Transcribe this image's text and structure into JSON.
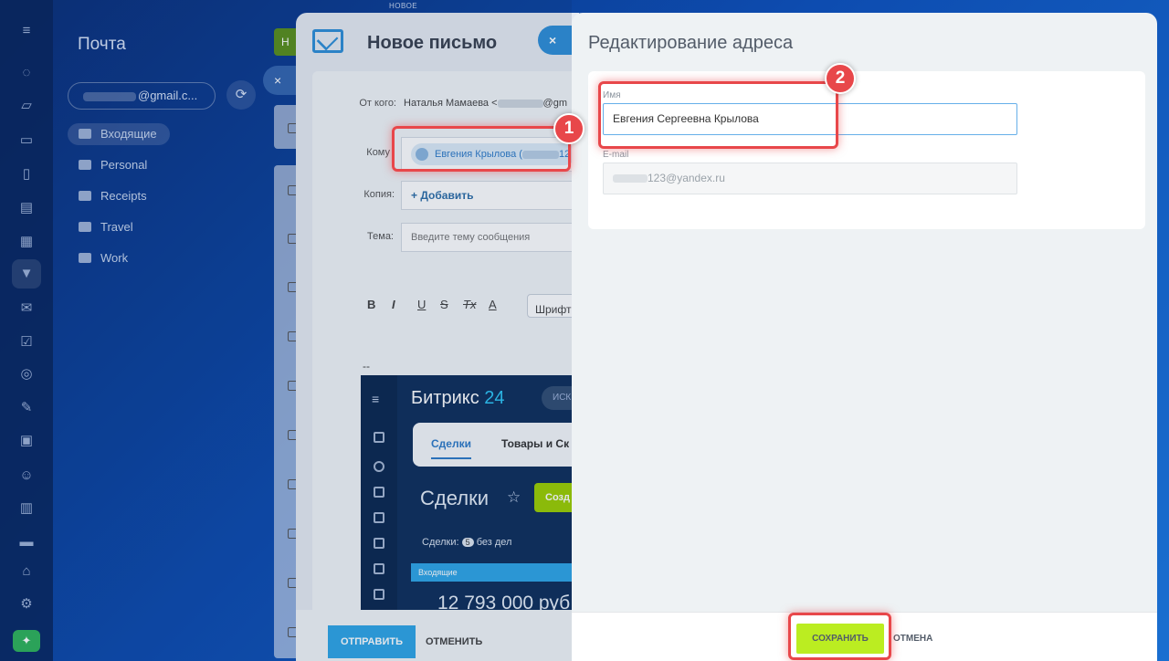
{
  "rail": {
    "icons": [
      "activity-icon",
      "feed-icon",
      "chat-icon",
      "calls-icon",
      "docs-icon",
      "calendar-icon",
      "crm-funnel-icon",
      "mail-icon",
      "tasks-icon",
      "goals-icon",
      "sign-icon",
      "projects-icon",
      "employees-icon",
      "documents-icon",
      "store-icon",
      "automation-icon",
      "settings-icon",
      "market-icon"
    ]
  },
  "mail": {
    "title": "Почта",
    "account": "@gmail.c...",
    "folders": [
      "Входящие",
      "Personal",
      "Receipts",
      "Travel",
      "Work"
    ],
    "create_label": "Н"
  },
  "top_strip": {
    "new_label": "НОВОЕ"
  },
  "letter": {
    "title": "Новое письмо",
    "close_icon": "×",
    "from_label": "От кого:",
    "from_value": "Наталья Мамаева <",
    "from_suffix": "@gm",
    "to_label": "Кому",
    "to_chip": "Евгения Крылова (",
    "to_chip_suffix": "12",
    "cc_label": "Копия:",
    "cc_add": "+ Добавить",
    "subject_label": "Тема:",
    "subject_placeholder": "Введите тему сообщения",
    "toolbar": {
      "bold": "B",
      "italic": "I",
      "underline": "U",
      "strike": "S",
      "clear": "Tx",
      "color": "A",
      "font": "Шрифт"
    },
    "signature_dash": "--",
    "send": "ОТПРАВИТЬ",
    "cancel": "ОТМЕНИТЬ"
  },
  "b24": {
    "logo": "Битрикс",
    "logo_num": "24",
    "search": "ИСК",
    "tab_deals": "Сделки",
    "tab_goods": "Товары и Ск",
    "deals_title": "Сделки",
    "create": "Созд",
    "count_label": "Сделки:",
    "count_value": "5",
    "count_suffix": "без дел",
    "column": "Входящие",
    "sum": "12 793 000 руб"
  },
  "edit": {
    "title": "Редактирование адреса",
    "name_label": "Имя",
    "name_value": "Евгения Сергеевна Крылова",
    "email_label": "E-mail",
    "email_value": "123@yandex.ru",
    "save": "СОХРАНИТЬ",
    "cancel": "ОТМЕНА"
  },
  "annotations": {
    "badge1": "1",
    "badge2": "2"
  },
  "colors": {
    "accent_blue": "#2fa6e6",
    "save_green": "#bbed21",
    "highlight_red": "#e8474a"
  }
}
